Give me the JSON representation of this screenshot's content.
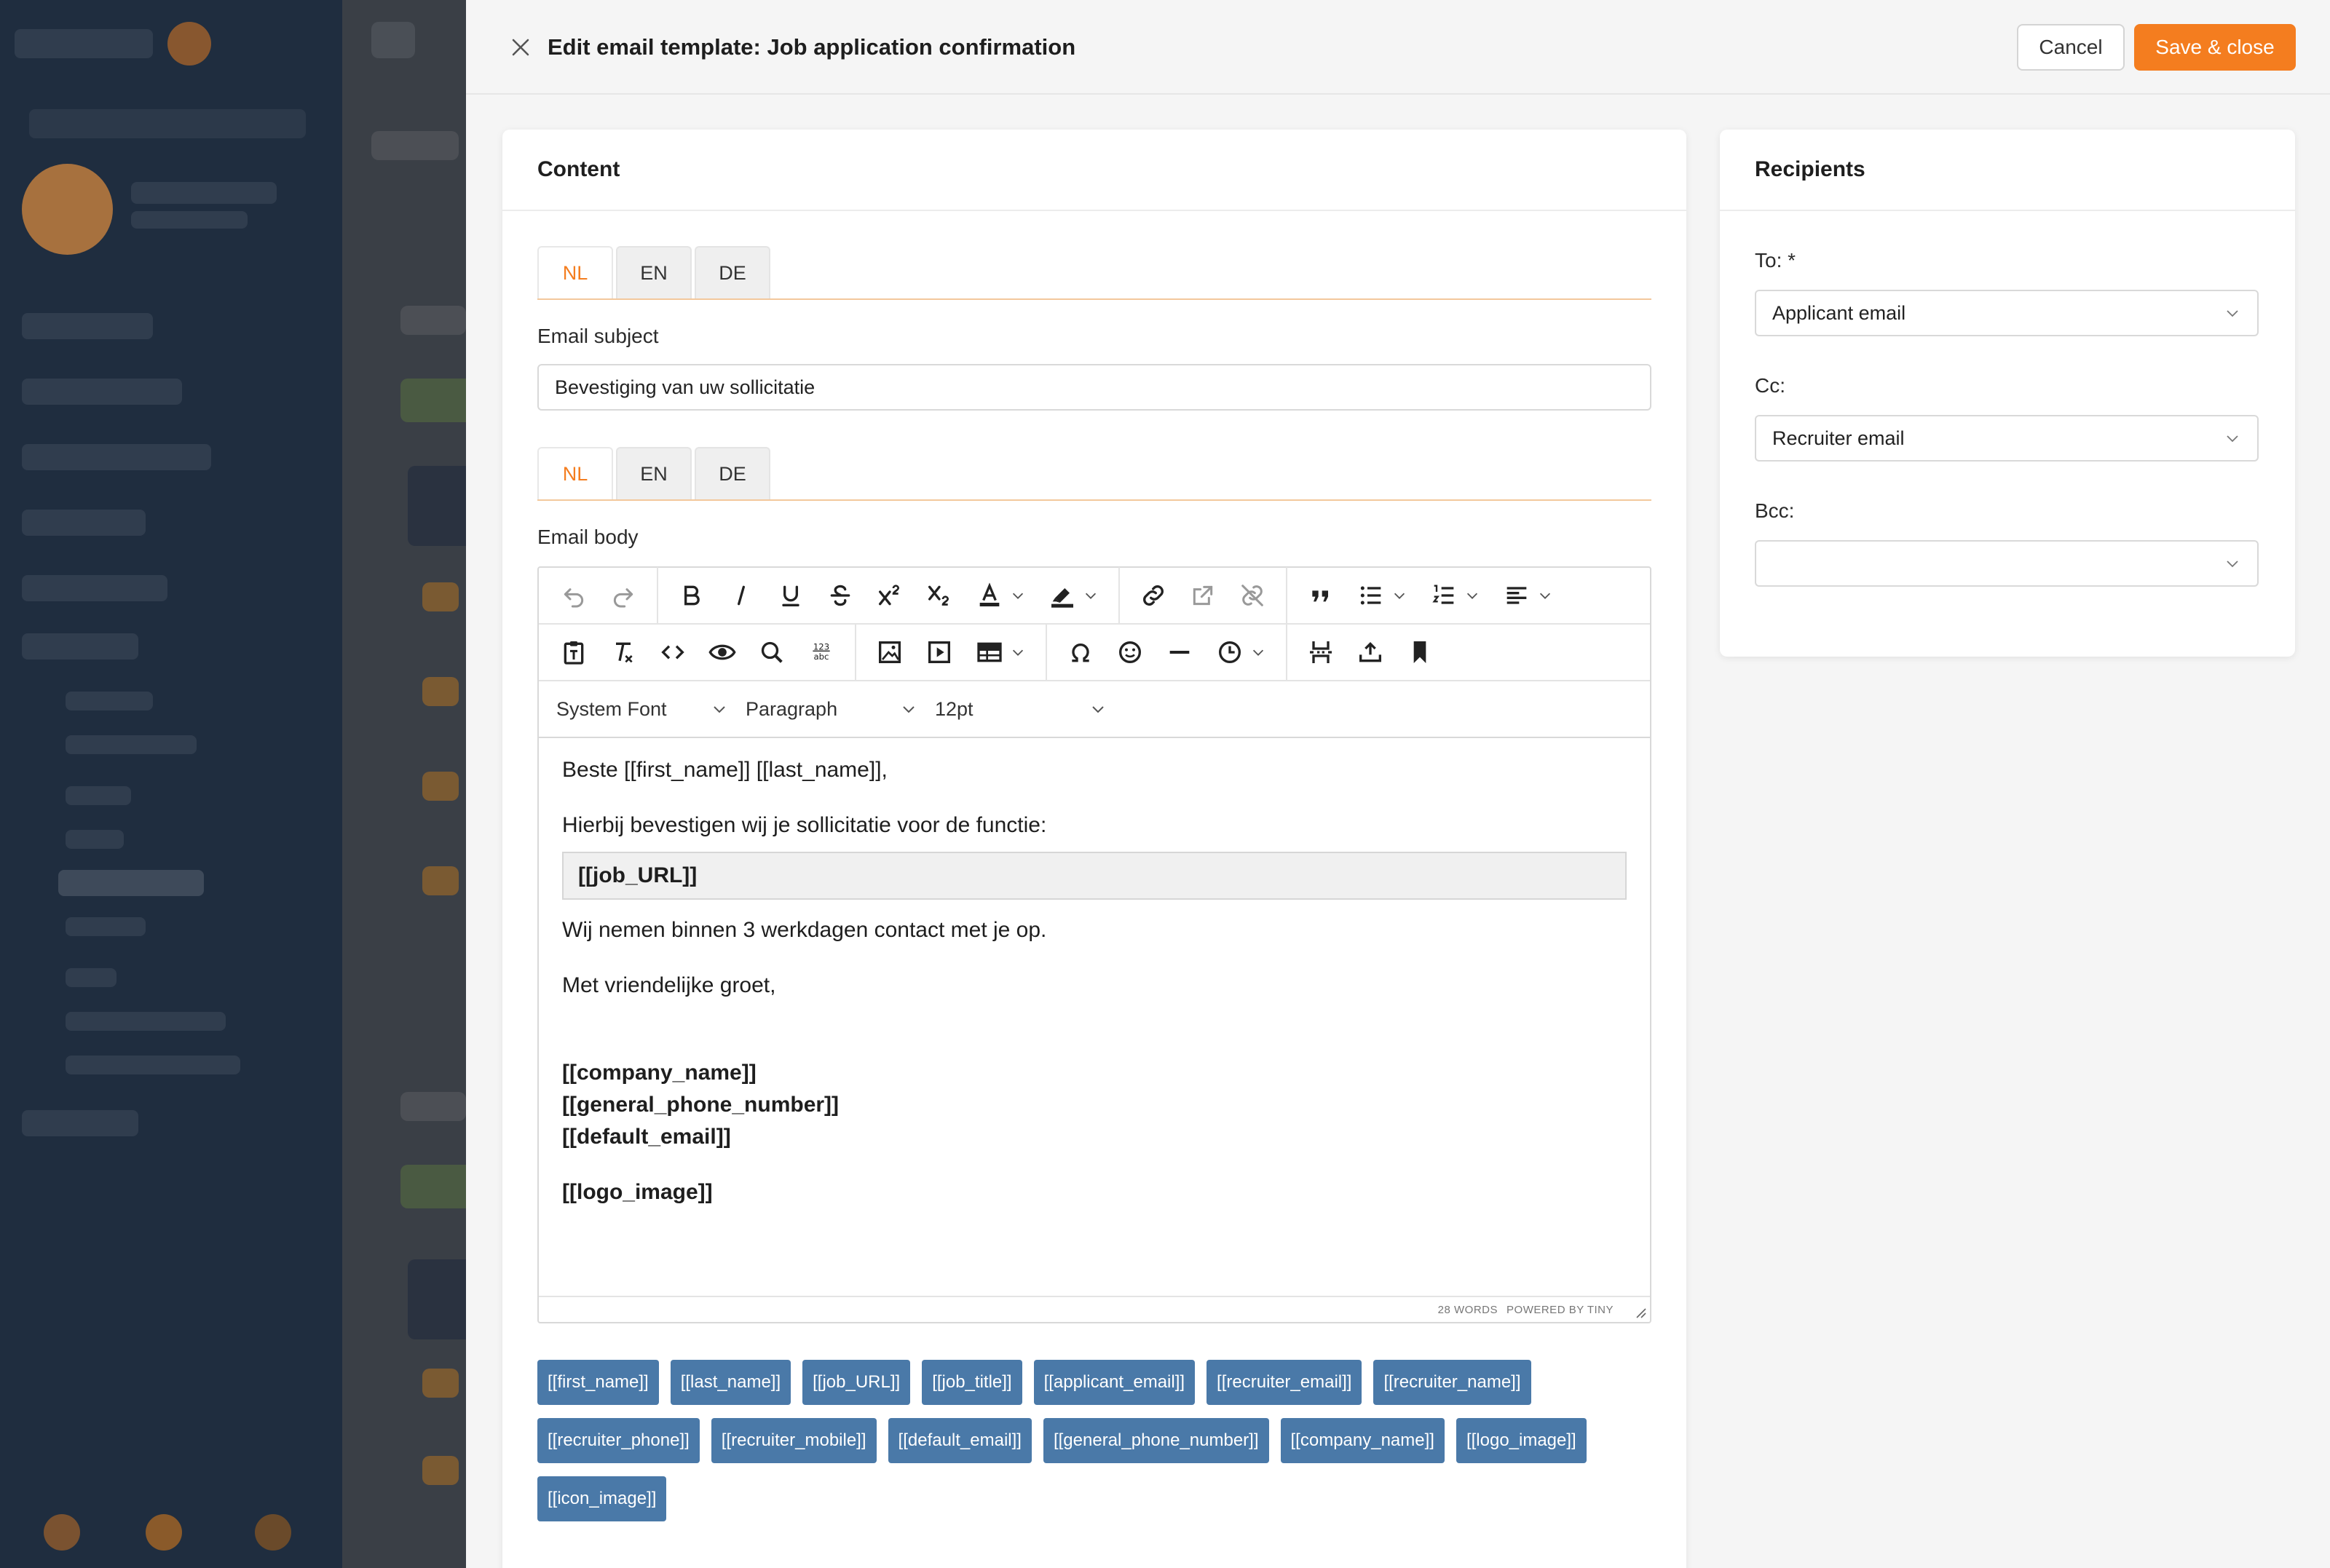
{
  "drawer": {
    "title": "Edit email template: Job application confirmation",
    "cancel_label": "Cancel",
    "save_label": "Save & close"
  },
  "content": {
    "heading": "Content",
    "subject_tabs": [
      "NL",
      "EN",
      "DE"
    ],
    "subject_label": "Email subject",
    "subject_value": "Bevestiging van uw sollicitatie",
    "body_tabs": [
      "NL",
      "EN",
      "DE"
    ],
    "body_label": "Email body",
    "font_select": "System Font",
    "block_select": "Paragraph",
    "size_select": "12pt",
    "body": {
      "greeting": "Beste [[first_name]] [[last_name]],",
      "line1": "Hierbij bevestigen wij je sollicitatie voor de functie:",
      "job_url": "[[job_URL]]",
      "line2": "Wij nemen binnen 3 werkdagen contact met je op.",
      "closing": "Met vriendelijke groet,",
      "company": "[[company_name]]",
      "phone": "[[general_phone_number]]",
      "email": "[[default_email]]",
      "logo": "[[logo_image]]"
    },
    "statusbar": {
      "words": "28 WORDS",
      "powered": "POWERED BY TINY"
    },
    "tags": [
      "[[first_name]]",
      "[[last_name]]",
      "[[job_URL]]",
      "[[job_title]]",
      "[[applicant_email]]",
      "[[recruiter_email]]",
      "[[recruiter_name]]",
      "[[recruiter_phone]]",
      "[[recruiter_mobile]]",
      "[[default_email]]",
      "[[general_phone_number]]",
      "[[company_name]]",
      "[[logo_image]]",
      "[[icon_image]]"
    ]
  },
  "recipients": {
    "heading": "Recipients",
    "to_label": "To: *",
    "to_value": "Applicant email",
    "cc_label": "Cc:",
    "cc_value": "Recruiter email",
    "bcc_label": "Bcc:",
    "bcc_value": ""
  },
  "colors": {
    "accent": "#f47d1f",
    "tag": "#4a79a8"
  }
}
